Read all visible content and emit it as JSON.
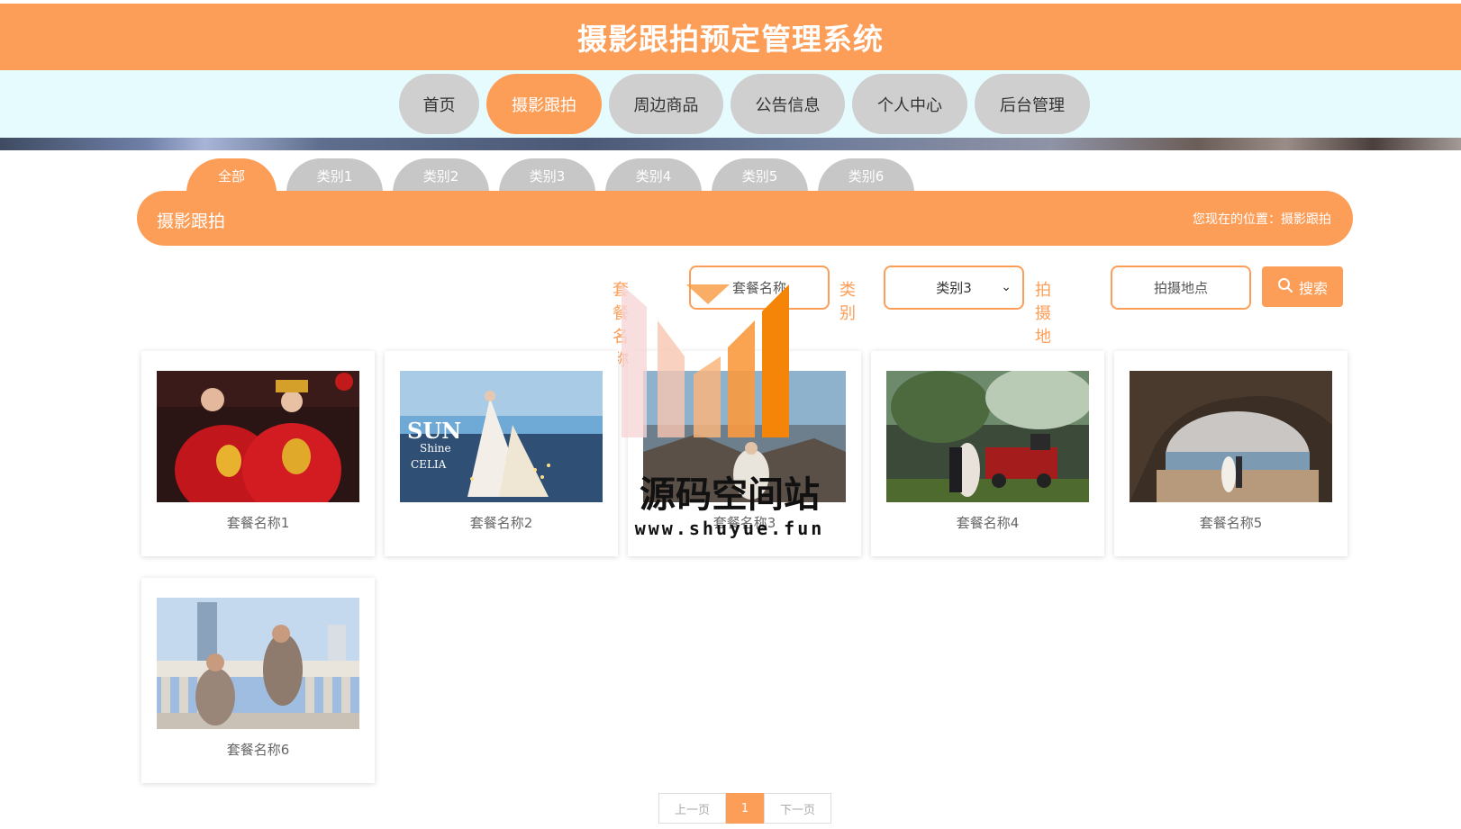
{
  "app": {
    "title": "摄影跟拍预定管理系统"
  },
  "nav": {
    "items": [
      {
        "label": "首页",
        "active": false
      },
      {
        "label": "摄影跟拍",
        "active": true
      },
      {
        "label": "周边商品",
        "active": false
      },
      {
        "label": "公告信息",
        "active": false
      },
      {
        "label": "个人中心",
        "active": false
      },
      {
        "label": "后台管理",
        "active": false
      }
    ]
  },
  "categories": {
    "tabs": [
      {
        "label": "全部",
        "active": true
      },
      {
        "label": "类别1",
        "active": false
      },
      {
        "label": "类别2",
        "active": false
      },
      {
        "label": "类别3",
        "active": false
      },
      {
        "label": "类别4",
        "active": false
      },
      {
        "label": "类别5",
        "active": false
      },
      {
        "label": "类别6",
        "active": false
      }
    ]
  },
  "section": {
    "title": "摄影跟拍",
    "location_prefix": "您现在的位置：",
    "location_current": "摄影跟拍"
  },
  "search": {
    "name_label": "套餐名称",
    "name_placeholder": "套餐名称",
    "category_label": "类别",
    "category_selected": "类别3",
    "place_label": "拍摄地点",
    "place_placeholder": "拍摄地点",
    "button_label": "搜索",
    "button_icon": "search-icon"
  },
  "packages": [
    {
      "name": "套餐名称1",
      "photo": "wedding-traditional-red"
    },
    {
      "name": "套餐名称2",
      "photo": "wedding-tent-seaside"
    },
    {
      "name": "套餐名称3",
      "photo": "couple-rocky-coast"
    },
    {
      "name": "套餐名称4",
      "photo": "couple-train-garden"
    },
    {
      "name": "套餐名称5",
      "photo": "couple-sea-cave"
    },
    {
      "name": "套餐名称6",
      "photo": "men-suits-balustrade"
    }
  ],
  "pagination": {
    "prev": "上一页",
    "current": "1",
    "next": "下一页"
  },
  "watermark": {
    "text": "源码空间站",
    "url": "www.shuyue.fun"
  },
  "colors": {
    "accent": "#fd9e58",
    "nav_band": "#e5fbfd",
    "tab_inactive": "#c7c7c7"
  }
}
